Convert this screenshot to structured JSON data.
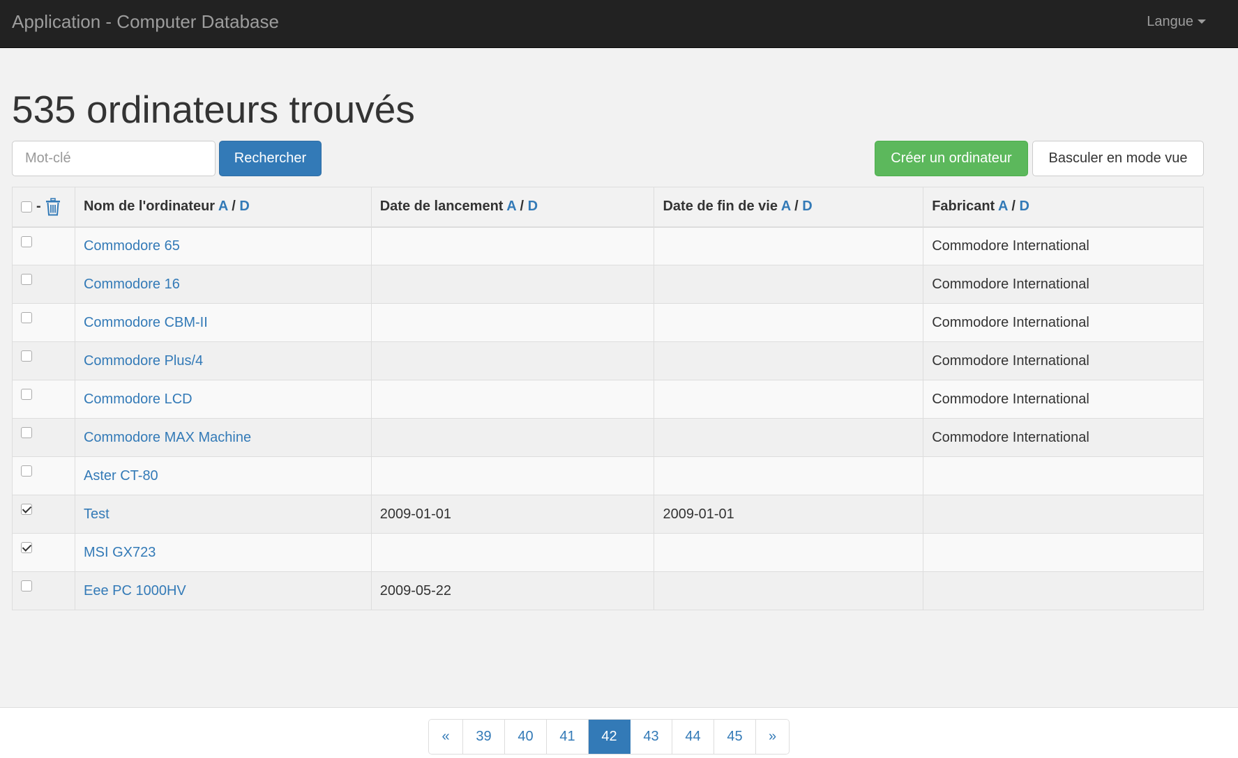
{
  "navbar": {
    "title": "Application - Computer Database",
    "language_label": "Langue"
  },
  "page_title": "535 ordinateurs trouvés",
  "search": {
    "placeholder": "Mot-clé",
    "value": "",
    "button_label": "Rechercher"
  },
  "actions": {
    "create_label": "Créer un ordinateur",
    "toggle_label": "Basculer en mode vue"
  },
  "table": {
    "header_separator": "-",
    "columns": [
      {
        "label": "Nom de l'ordinateur",
        "asc": "A",
        "desc": "D"
      },
      {
        "label": "Date de lancement",
        "asc": "A",
        "desc": "D"
      },
      {
        "label": "Date de fin de vie",
        "asc": "A",
        "desc": "D"
      },
      {
        "label": "Fabricant",
        "asc": "A",
        "desc": "D"
      }
    ],
    "sort_divider": "/",
    "rows": [
      {
        "checked": false,
        "name": "Commodore 65",
        "introduced": "",
        "discontinued": "",
        "company": "Commodore International"
      },
      {
        "checked": false,
        "name": "Commodore 16",
        "introduced": "",
        "discontinued": "",
        "company": "Commodore International"
      },
      {
        "checked": false,
        "name": "Commodore CBM-II",
        "introduced": "",
        "discontinued": "",
        "company": "Commodore International"
      },
      {
        "checked": false,
        "name": "Commodore Plus/4",
        "introduced": "",
        "discontinued": "",
        "company": "Commodore International"
      },
      {
        "checked": false,
        "name": "Commodore LCD",
        "introduced": "",
        "discontinued": "",
        "company": "Commodore International"
      },
      {
        "checked": false,
        "name": "Commodore MAX Machine",
        "introduced": "",
        "discontinued": "",
        "company": "Commodore International"
      },
      {
        "checked": false,
        "name": "Aster CT-80",
        "introduced": "",
        "discontinued": "",
        "company": ""
      },
      {
        "checked": true,
        "name": "Test",
        "introduced": "2009-01-01",
        "discontinued": "2009-01-01",
        "company": ""
      },
      {
        "checked": true,
        "name": "MSI GX723",
        "introduced": "",
        "discontinued": "",
        "company": ""
      },
      {
        "checked": false,
        "name": "Eee PC 1000HV",
        "introduced": "2009-05-22",
        "discontinued": "",
        "company": ""
      }
    ]
  },
  "pagination": {
    "prev": "«",
    "next": "»",
    "pages": [
      "39",
      "40",
      "41",
      "42",
      "43",
      "44",
      "45"
    ],
    "active": "42"
  },
  "colors": {
    "navbar_bg": "#222222",
    "primary": "#337ab7",
    "success": "#5cb85c",
    "page_bg": "#f2f2f2"
  },
  "icons": {
    "delete": "trash-icon",
    "language": "caret-down-icon"
  }
}
